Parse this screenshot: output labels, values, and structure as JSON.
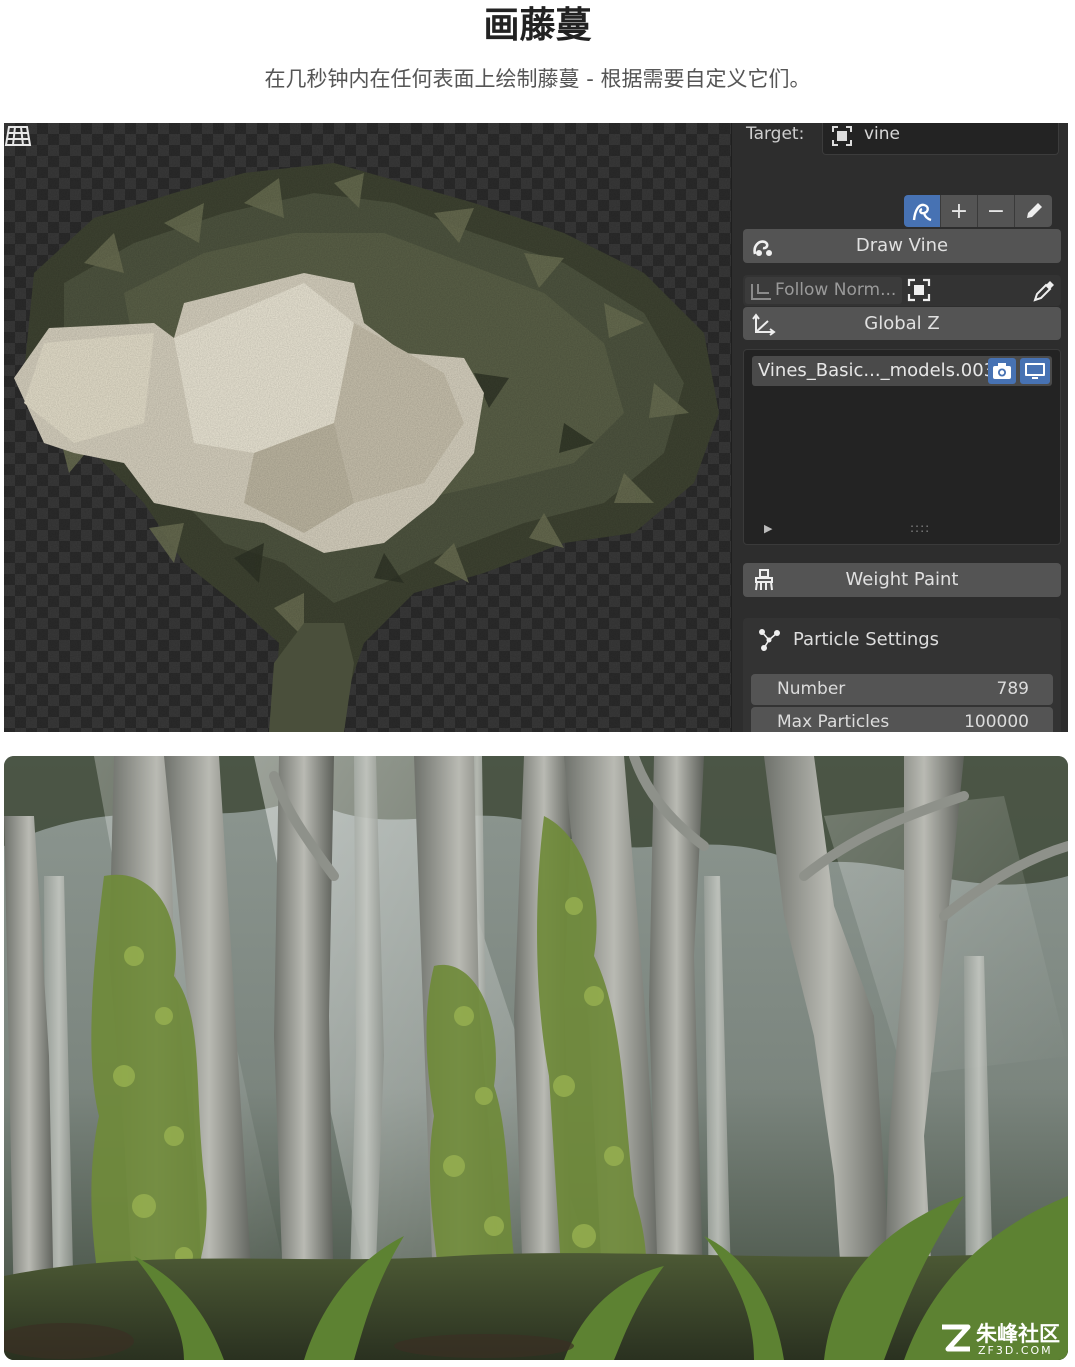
{
  "header": {
    "title": "画藤蔓",
    "subtitle": "在几秒钟内在任何表面上绘制藤蔓 - 根据需要自定义它们。"
  },
  "panel": {
    "target_label": "Target:",
    "target_value": "vine",
    "tools": [
      "vine-tool",
      "+",
      "−",
      "pencil"
    ],
    "draw_vine_label": "Draw Vine",
    "follow_normal_label": "Follow Norm...",
    "global_z_label": "Global Z",
    "list_items": [
      "Vines_Basic..._models.003"
    ],
    "weight_paint_label": "Weight Paint",
    "particle_settings_title": "Particle Settings",
    "properties": [
      {
        "label": "Number",
        "value": "789"
      },
      {
        "label": "Max Particles",
        "value": "100000"
      }
    ]
  },
  "watermark": {
    "name": "朱峰社区",
    "url": "ZF3D.COM"
  },
  "colors": {
    "accent_blue": "#4772b3",
    "panel_bg": "#2d2d2d",
    "button_bg": "#545454"
  }
}
